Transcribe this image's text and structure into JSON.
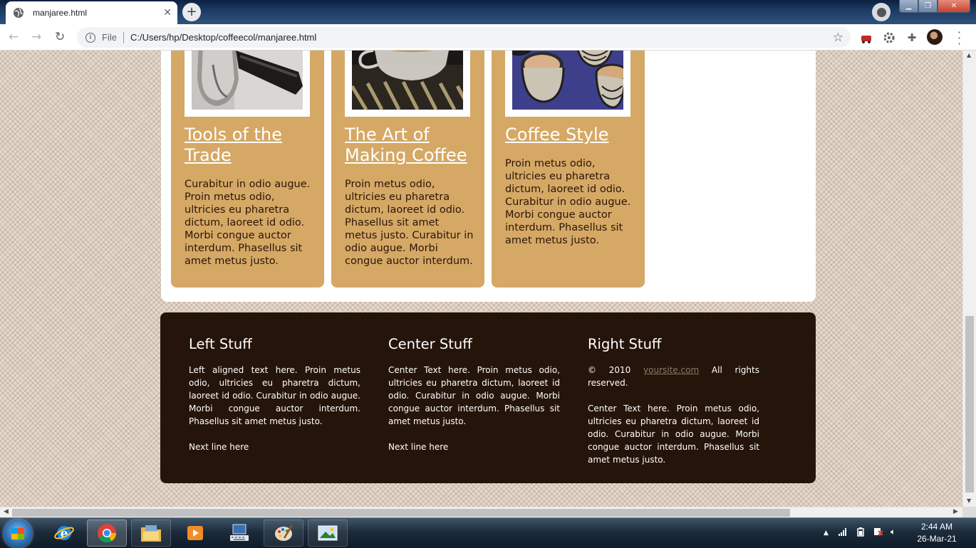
{
  "browser": {
    "tab": {
      "title": "manjaree.html",
      "close_glyph": "✕"
    },
    "new_tab_glyph": "+",
    "address": {
      "scheme_label": "File",
      "url": "C:/Users/hp/Desktop/coffeecol/manjaree.html"
    }
  },
  "page": {
    "cards": [
      {
        "title": "Tools of the Trade",
        "text": "Curabitur in odio augue. Proin metus odio, ultricies eu pharetra dictum, laoreet id odio. Morbi congue auctor interdum. Phasellus sit amet metus justo."
      },
      {
        "title": "The Art of Making Coffee",
        "text": "Proin metus odio, ultricies eu pharetra dictum, laoreet id odio. Phasellus sit amet metus justo. Curabitur in odio augue. Morbi congue auctor interdum."
      },
      {
        "title": "Coffee Style",
        "text": "Proin metus odio, ultricies eu pharetra dictum, laoreet id odio. Curabitur in odio augue. Morbi congue auctor interdum. Phasellus sit amet metus justo."
      }
    ],
    "footer": {
      "left": {
        "heading": "Left Stuff",
        "text": "Left aligned text here. Proin metus odio, ultricies eu pharetra dictum, laoreet id odio. Curabitur in odio augue. Morbi congue auctor interdum. Phasellus sit amet metus justo.",
        "next_line": "Next line here"
      },
      "center": {
        "heading": "Center Stuff",
        "text": "Center Text here. Proin metus odio, ultricies eu pharetra dictum, laoreet id odio. Curabitur in odio augue. Morbi congue auctor interdum. Phasellus sit amet metus justo.",
        "next_line": "Next line here"
      },
      "right": {
        "heading": "Right Stuff",
        "copyright_prefix": "© 2010",
        "site_link": "yoursite.com",
        "rights": "All rights reserved.",
        "text": "Center Text here. Proin metus odio, ultricies eu pharetra dictum, laoreet id odio. Curabitur in odio augue. Morbi congue auctor interdum. Phasellus sit amet metus justo."
      }
    }
  },
  "taskbar": {
    "time": "2:44 AM",
    "date": "26-Mar-21"
  },
  "colors": {
    "card": "#d5a865",
    "footer": "#251409",
    "link_white": "#ffffff"
  }
}
